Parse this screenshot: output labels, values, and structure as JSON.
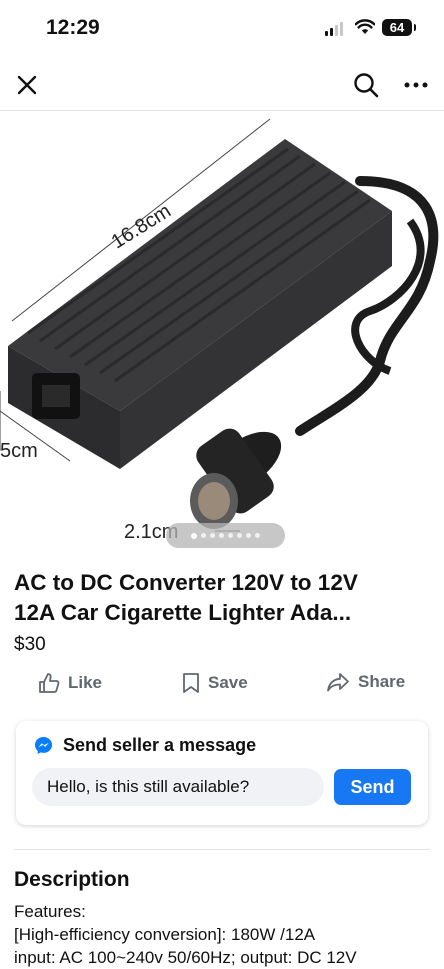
{
  "status": {
    "time": "12:29",
    "battery": "64"
  },
  "nav": {
    "close_icon": "close-icon",
    "search_icon": "search-icon",
    "more_icon": "more-icon"
  },
  "image": {
    "dimension_length": "16.8cm",
    "dimension_height": "5cm",
    "dimension_cable": "2.1cm",
    "photo_count": 8,
    "current_photo": 1
  },
  "listing": {
    "title_line1": "AC to DC Converter 120V to 12V",
    "title_line2": "12A Car Cigarette Lighter Ada...",
    "price": "$30"
  },
  "actions": {
    "like_label": "Like",
    "save_label": "Save",
    "share_label": "Share"
  },
  "message": {
    "header": "Send seller a message",
    "input_value": "Hello, is this still available?",
    "send_label": "Send"
  },
  "description": {
    "heading": "Description",
    "lines": [
      "Features:",
      "[High-efficiency conversion]: 180W /12A",
      "input: AC 100~240v 50/60Hz; output: DC 12V"
    ]
  },
  "colors": {
    "accent": "#1877f2",
    "action_gray": "#606770",
    "messenger_blue": "#0a7cff"
  }
}
